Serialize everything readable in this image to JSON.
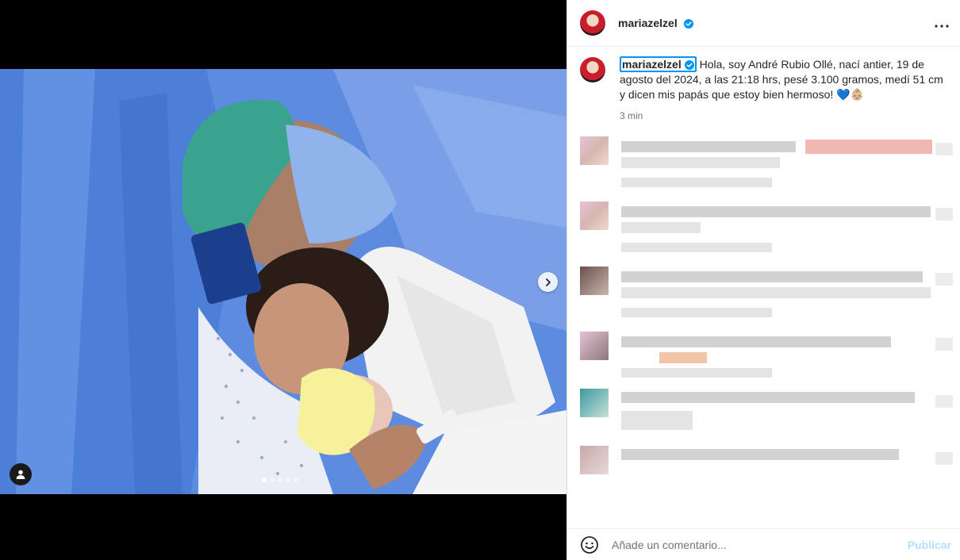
{
  "post": {
    "username": "mariazelzel",
    "caption_text": "Hola, soy André Rubio Ollé, nací antier, 19 de agosto del 2024, a las 21:18 hrs, pesé 3.100 gramos, medí 51 cm y dicen mis papás que estoy bien hermoso! 💙👶🏼",
    "timestamp": "3 min",
    "carousel_current": 1,
    "carousel_total": 5
  },
  "comment_box": {
    "placeholder": "Añade un comentario...",
    "publish_label": "Publicar"
  },
  "icons": {
    "verified": "verified-badge-icon",
    "more": "more-options-icon",
    "next": "chevron-right-icon",
    "tag": "person-tag-icon",
    "emoji": "emoji-icon"
  },
  "colors": {
    "accent": "#0095f6",
    "publish_disabled": "#b2dffc"
  }
}
